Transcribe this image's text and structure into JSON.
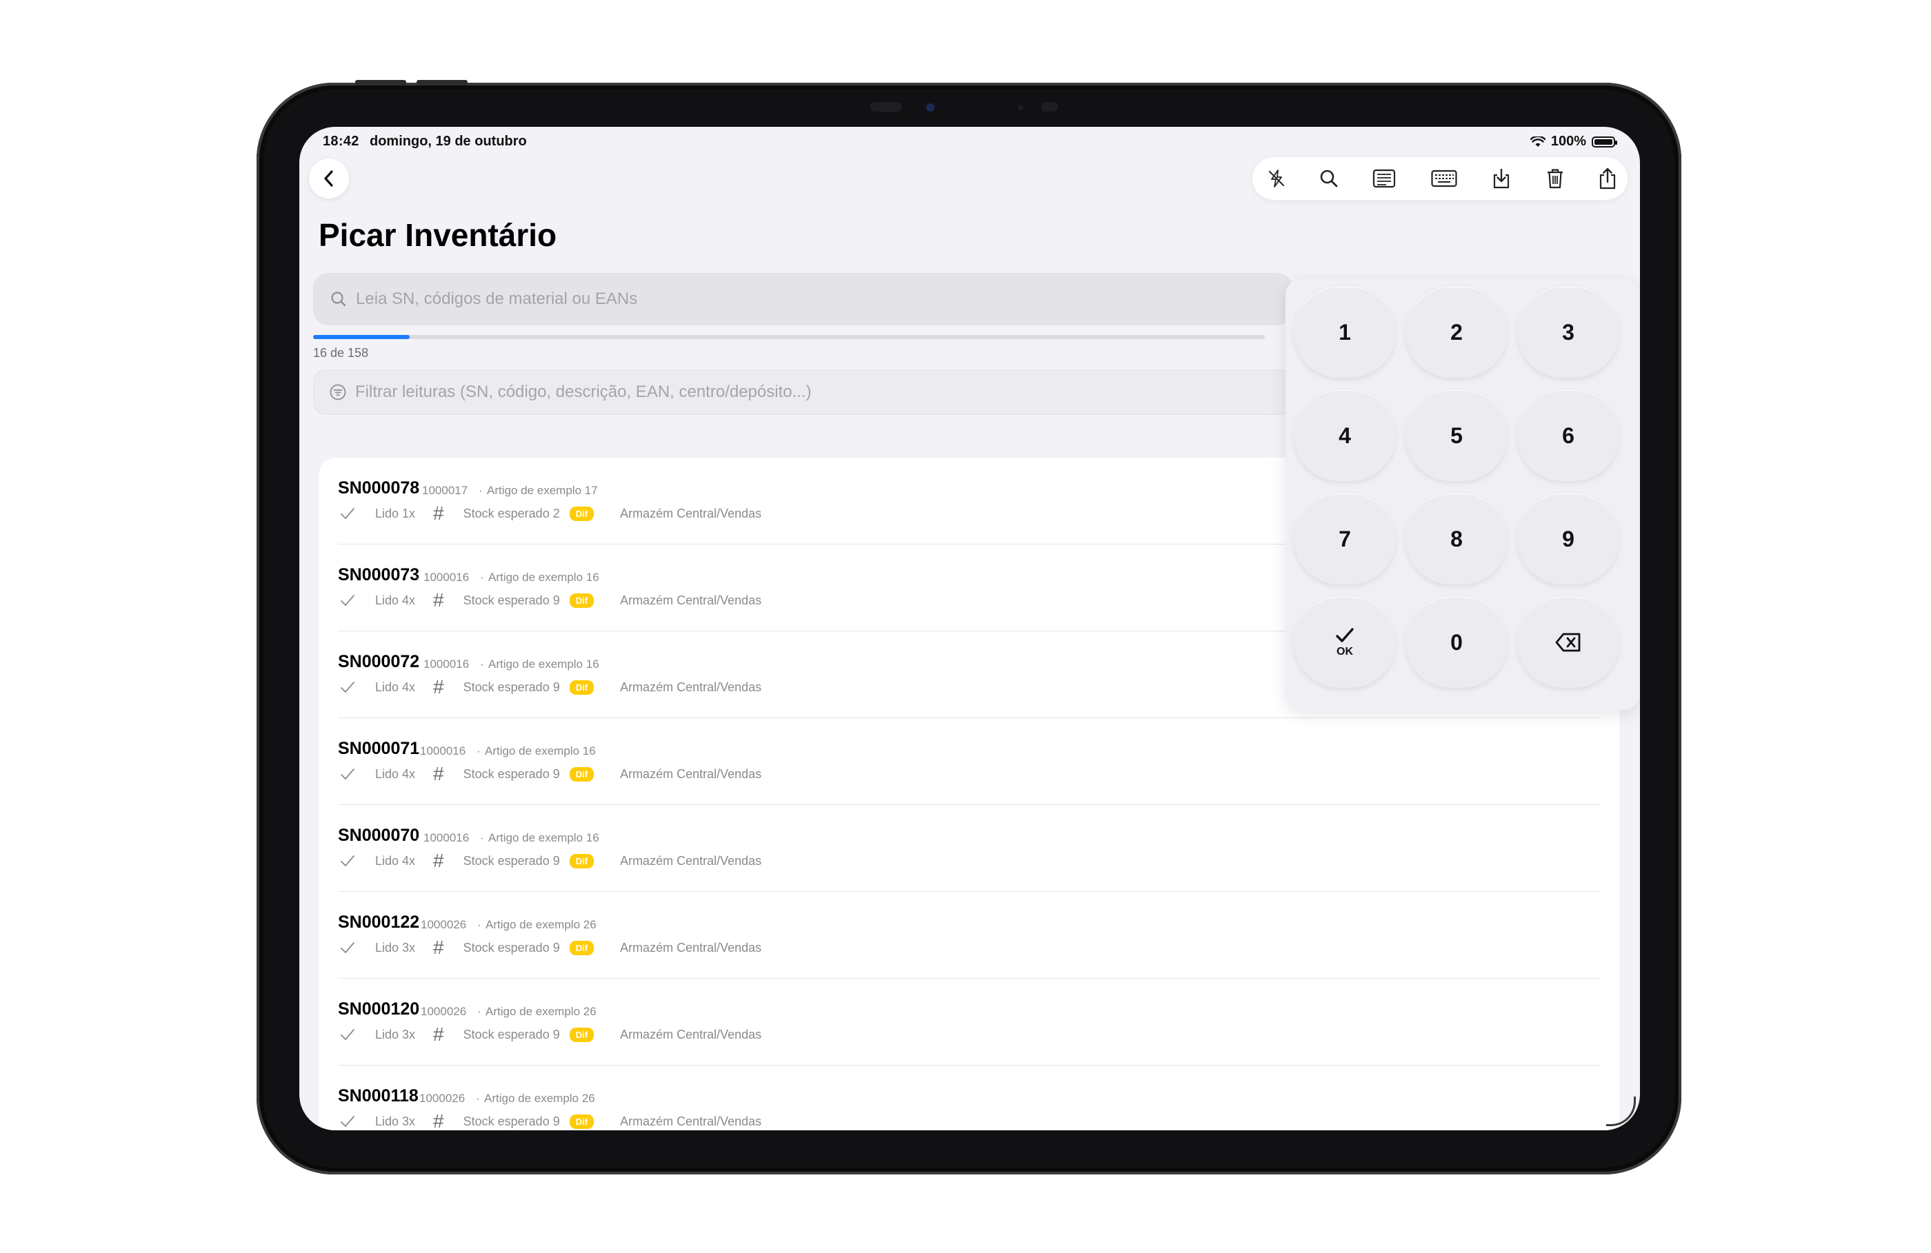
{
  "status": {
    "time": "18:42",
    "date": "domingo, 19 de outubro",
    "battery": "100%"
  },
  "title": "Picar Inventário",
  "search": {
    "placeholder": "Leia SN, códigos de material ou EANs"
  },
  "progress": {
    "text": "16 de 158",
    "current": 16,
    "total": 158
  },
  "filter": {
    "placeholder": "Filtrar leituras (SN, código, descrição, EAN, centro/depósito...)"
  },
  "toolbar_icons": [
    "flash-off-icon",
    "search-icon",
    "list-icon",
    "keyboard-icon",
    "download-icon",
    "trash-icon",
    "share-icon"
  ],
  "items": [
    {
      "sn": "SN000078",
      "code": "1000017",
      "desc": "Artigo de exemplo 17",
      "read": "Lido 1x",
      "stock": "Stock esperado 2",
      "badge": "Dif",
      "location": "Armazém Central/Vendas"
    },
    {
      "sn": "SN000073",
      "code": "1000016",
      "desc": "Artigo de exemplo 16",
      "read": "Lido 4x",
      "stock": "Stock esperado 9",
      "badge": "Dif",
      "location": "Armazém Central/Vendas"
    },
    {
      "sn": "SN000072",
      "code": "1000016",
      "desc": "Artigo de exemplo 16",
      "read": "Lido 4x",
      "stock": "Stock esperado 9",
      "badge": "Dif",
      "location": "Armazém Central/Vendas"
    },
    {
      "sn": "SN000071",
      "code": "1000016",
      "desc": "Artigo de exemplo 16",
      "read": "Lido 4x",
      "stock": "Stock esperado 9",
      "badge": "Dif",
      "location": "Armazém Central/Vendas"
    },
    {
      "sn": "SN000070",
      "code": "1000016",
      "desc": "Artigo de exemplo 16",
      "read": "Lido 4x",
      "stock": "Stock esperado 9",
      "badge": "Dif",
      "location": "Armazém Central/Vendas"
    },
    {
      "sn": "SN000122",
      "code": "1000026",
      "desc": "Artigo de exemplo 26",
      "read": "Lido 3x",
      "stock": "Stock esperado 9",
      "badge": "Dif",
      "location": "Armazém Central/Vendas"
    },
    {
      "sn": "SN000120",
      "code": "1000026",
      "desc": "Artigo de exemplo 26",
      "read": "Lido 3x",
      "stock": "Stock esperado 9",
      "badge": "Dif",
      "location": "Armazém Central/Vendas"
    },
    {
      "sn": "SN000118",
      "code": "1000026",
      "desc": "Artigo de exemplo 26",
      "read": "Lido 3x",
      "stock": "Stock esperado 9",
      "badge": "Dif",
      "location": "Armazém Central/Vendas"
    }
  ],
  "keypad": {
    "keys": [
      "1",
      "2",
      "3",
      "4",
      "5",
      "6",
      "7",
      "8",
      "9"
    ],
    "ok": "OK",
    "zero": "0"
  },
  "colors": {
    "accent": "#1a7bff",
    "badge": "#ffcc0a",
    "background": "#f2f2f7"
  }
}
